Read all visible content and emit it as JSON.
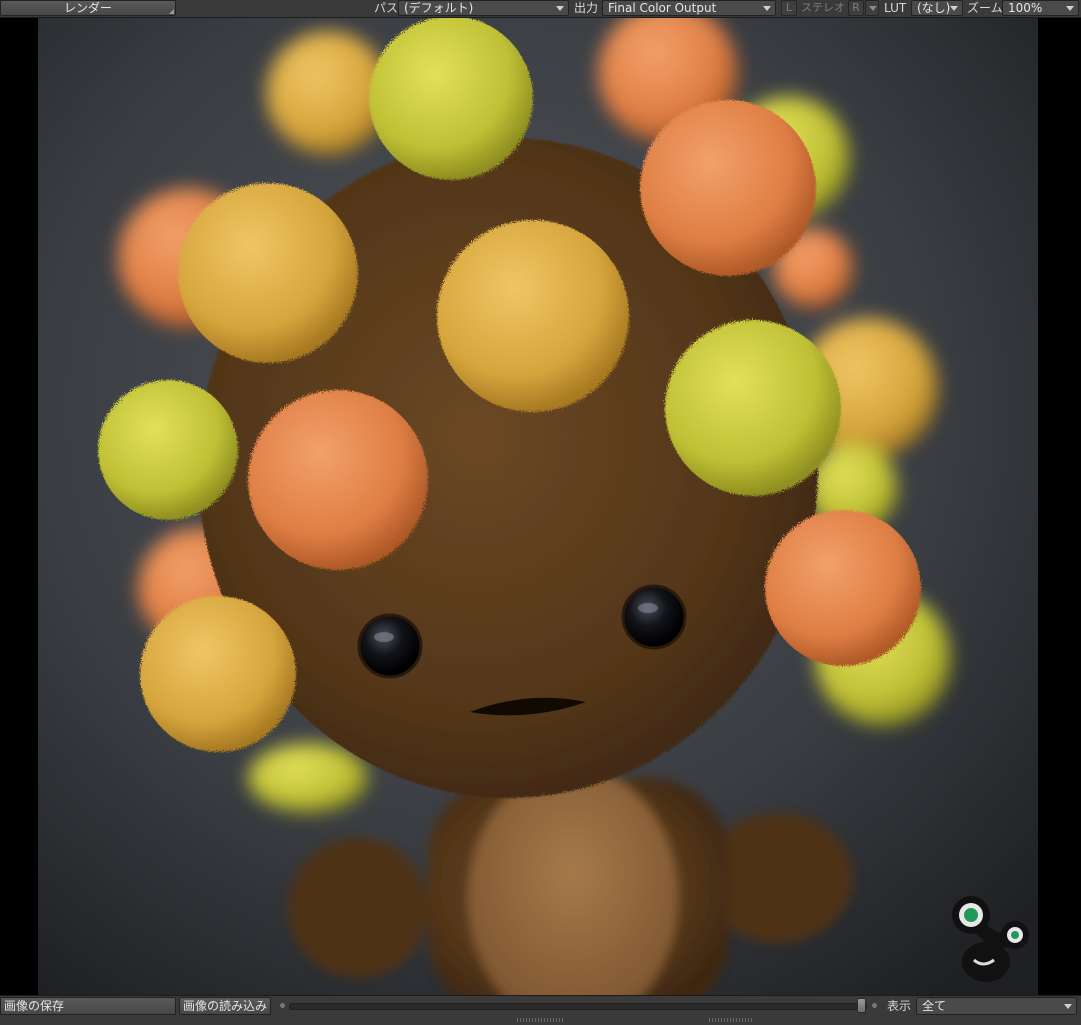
{
  "toolbar": {
    "render_label": "レンダー",
    "pass_label": "パス",
    "pass_value": "(デフォルト)",
    "output_label": "出力",
    "output_value": "Final Color Output",
    "left_eye_btn": "L",
    "stereo_label": "ステレオ",
    "right_eye_btn": "R",
    "lut_label": "LUT",
    "lut_value": "(なし)",
    "zoom_label": "ズーム",
    "zoom_value": "100%"
  },
  "viewport": {
    "subject": "fuzzy brown creature with colorful pom-pom balls",
    "logo_icon": "modo-mascot-logo-icon",
    "colors": {
      "background": "#000000",
      "studio_gray": "#3c3f44",
      "fur_brown": "#5a3a1c",
      "pom_yellow_green": "#c9c83a",
      "pom_orange": "#e0854a",
      "pom_gold": "#d8a93e"
    }
  },
  "bottombar": {
    "save_image_label": "画像の保存",
    "load_image_label": "画像の読み込み",
    "display_label": "表示",
    "display_value": "全て"
  }
}
